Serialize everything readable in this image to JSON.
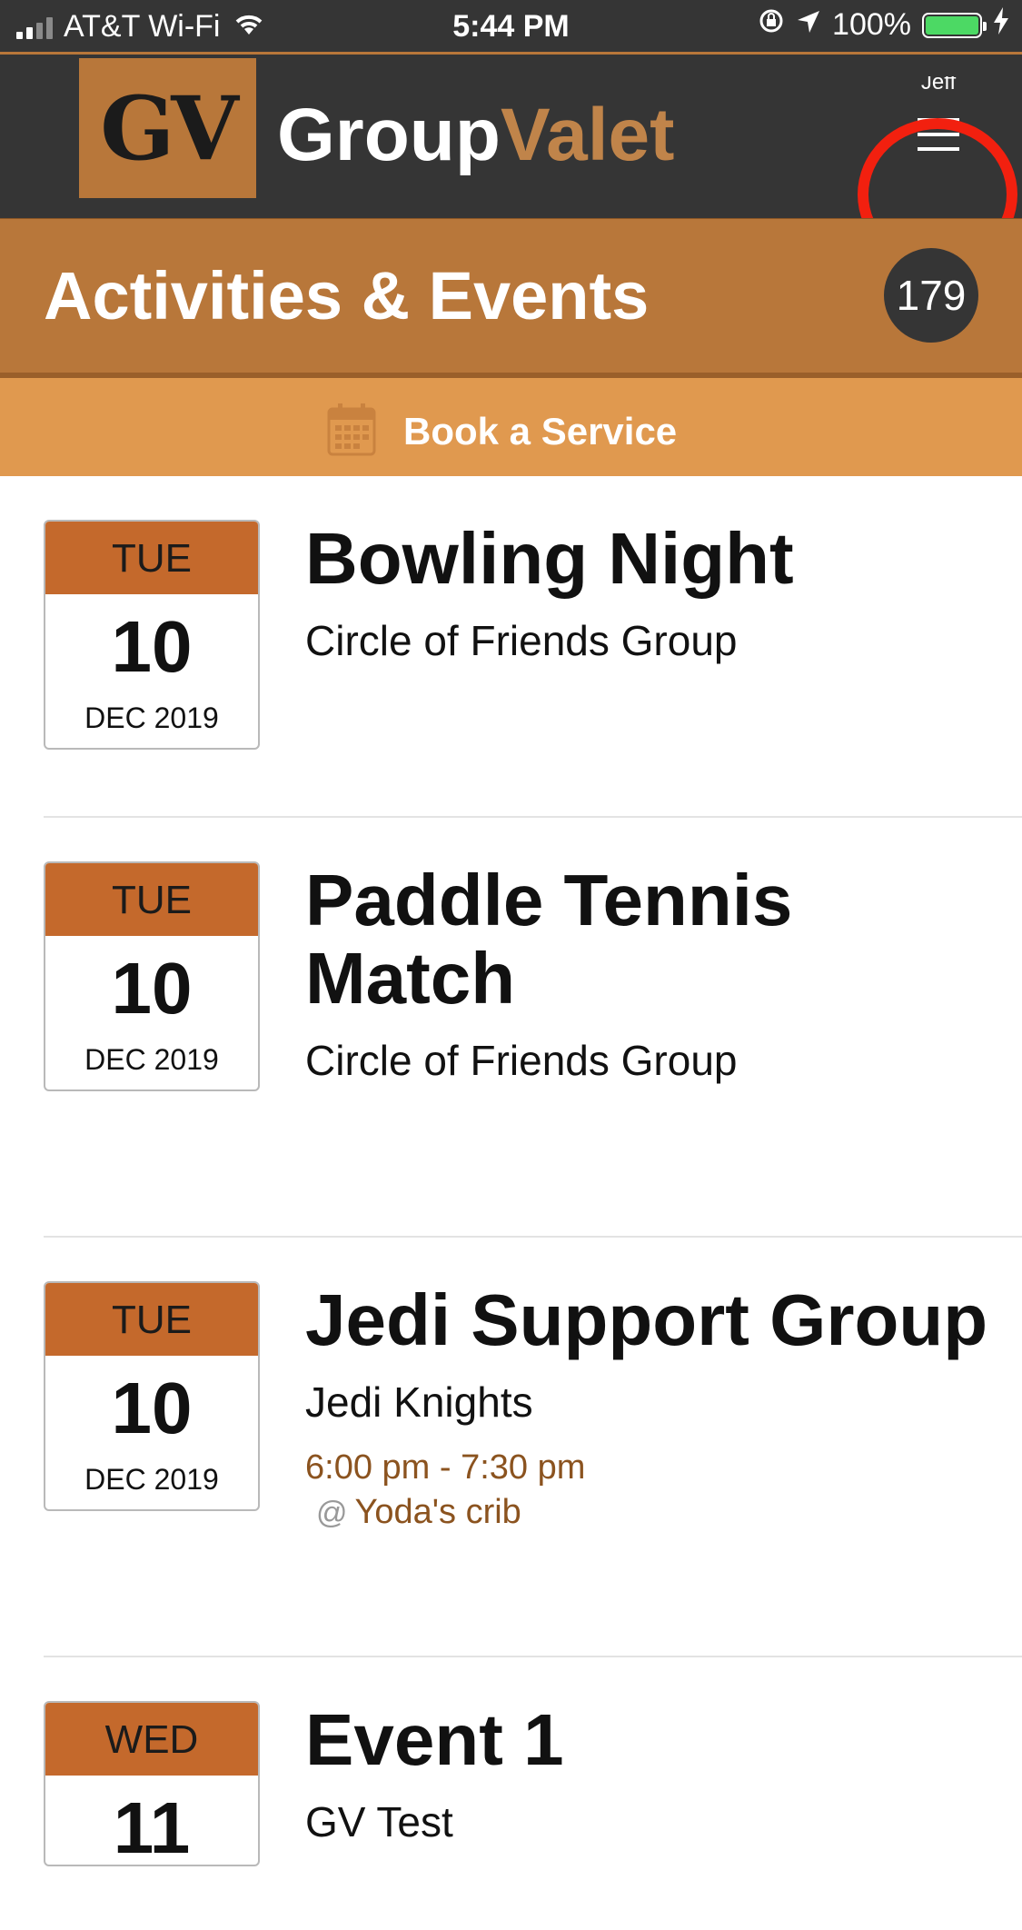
{
  "status_bar": {
    "carrier": "AT&T Wi-Fi",
    "time": "5:44 PM",
    "battery": "100%",
    "colors": {
      "battery_fill": "#4cd964"
    }
  },
  "header": {
    "logo_text": "GV",
    "brand_part1": "Group",
    "brand_part2": "Valet",
    "user_name": "Jeff",
    "menu_icon": "hamburger-menu-icon",
    "highlight_color": "#f2200f"
  },
  "page": {
    "title": "Activities & Events",
    "count": "179",
    "book_service_label": "Book a Service",
    "book_service_icon": "calendar-icon"
  },
  "colors": {
    "dark": "#353535",
    "brand_brown": "#b8773a",
    "light_orange": "#e0994f",
    "date_header": "#c4692c",
    "time_text": "#8b531f"
  },
  "events": [
    {
      "dow": "TUE",
      "day": "10",
      "month_year": "DEC 2019",
      "title": "Bowling Night",
      "group": "Circle of Friends Group",
      "time": "",
      "location": ""
    },
    {
      "dow": "TUE",
      "day": "10",
      "month_year": "DEC 2019",
      "title": "Paddle Tennis Match",
      "group": "Circle of Friends Group",
      "time": "",
      "location": ""
    },
    {
      "dow": "TUE",
      "day": "10",
      "month_year": "DEC 2019",
      "title": "Jedi Support Group",
      "group": "Jedi Knights",
      "time": "6:00 pm - 7:30 pm",
      "location": "Yoda's crib"
    },
    {
      "dow": "WED",
      "day": "11",
      "month_year": "",
      "title": "Event 1",
      "group": "GV Test",
      "time": "",
      "location": ""
    }
  ]
}
